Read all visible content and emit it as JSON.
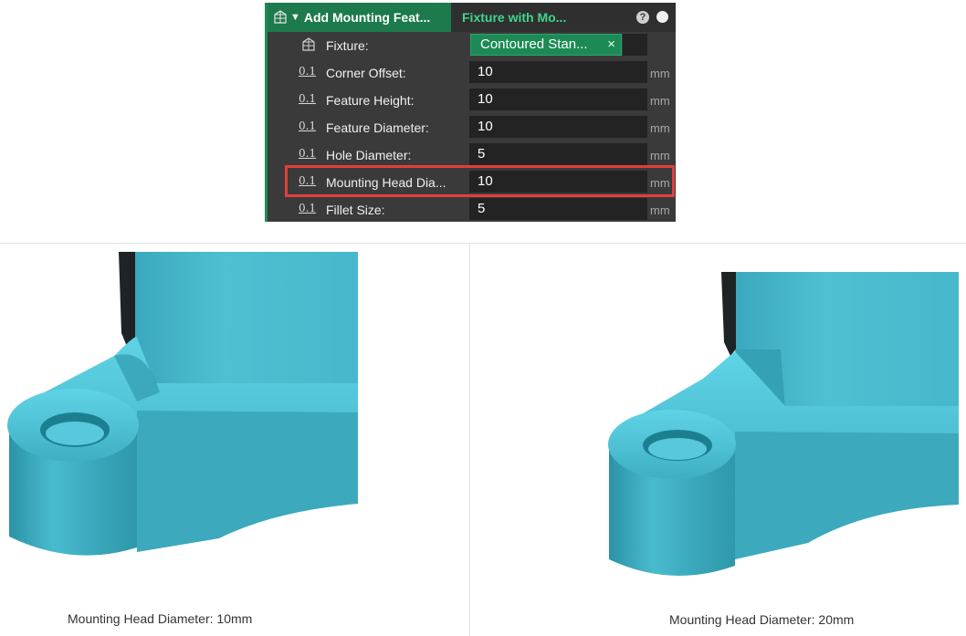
{
  "panel": {
    "header_title": "Add Mounting Feat...",
    "header_tab2": "Fixture with Mo...",
    "help_glyph": "?",
    "fixture": {
      "label": "Fixture:",
      "value": "Contoured Stan...",
      "clear_glyph": "×"
    },
    "fields": [
      {
        "icon": "0.1",
        "label": "Corner Offset:",
        "value": "10",
        "unit": "mm"
      },
      {
        "icon": "0.1",
        "label": "Feature Height:",
        "value": "10",
        "unit": "mm"
      },
      {
        "icon": "0.1",
        "label": "Feature Diameter:",
        "value": "10",
        "unit": "mm"
      },
      {
        "icon": "0.1",
        "label": "Hole Diameter:",
        "value": "5",
        "unit": "mm"
      },
      {
        "icon": "0.1",
        "label": "Mounting Head Dia...",
        "value": "10",
        "unit": "mm"
      },
      {
        "icon": "0.1",
        "label": "Fillet Size:",
        "value": "5",
        "unit": "mm"
      }
    ]
  },
  "colors": {
    "accent_green": "#1c7a4c",
    "tab_green": "#3fd58e",
    "highlight_red": "#e0403a",
    "part_cyan": "#4ab8cc"
  },
  "captions": {
    "left": "Mounting Head Diameter: 10mm",
    "right": "Mounting Head Diameter: 20mm"
  }
}
